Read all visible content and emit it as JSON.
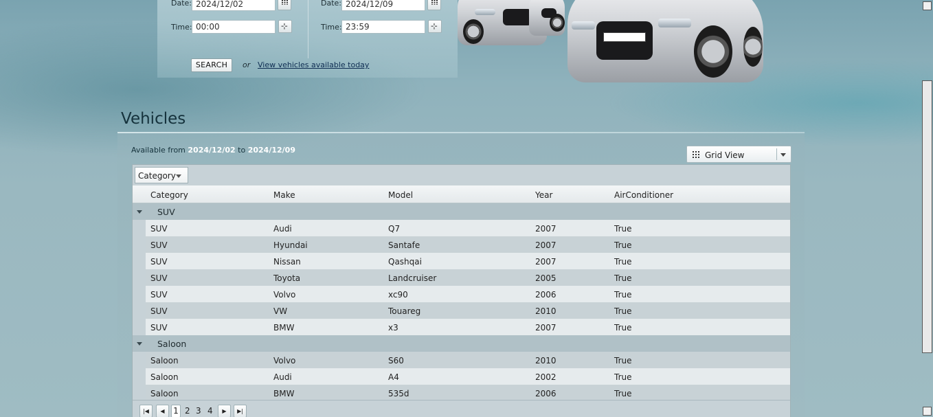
{
  "search": {
    "from_date_label": "Date:",
    "from_date_value": "2024/12/02",
    "from_time_label": "Time:",
    "from_time_value": "00:00",
    "to_date_label": "Date:",
    "to_date_value": "2024/12/09",
    "to_time_label": "Time:",
    "to_time_value": "23:59",
    "search_button": "SEARCH",
    "or_text": "or",
    "today_link": "View vehicles available today"
  },
  "vehicles": {
    "title": "Vehicles",
    "available_prefix": "Available from",
    "available_from": "2024/12/02",
    "available_to_word": "to",
    "available_to": "2024/12/09",
    "view_select": "Grid View",
    "group_chip": "Category"
  },
  "grid": {
    "columns": [
      "Category",
      "Make",
      "Model",
      "Year",
      "AirConditioner"
    ],
    "groups": [
      {
        "label": "SUV",
        "rows": [
          [
            "SUV",
            "Audi",
            "Q7",
            "2007",
            "True"
          ],
          [
            "SUV",
            "Hyundai",
            "Santafe",
            "2007",
            "True"
          ],
          [
            "SUV",
            "Nissan",
            "Qashqai",
            "2007",
            "True"
          ],
          [
            "SUV",
            "Toyota",
            "Landcruiser",
            "2005",
            "True"
          ],
          [
            "SUV",
            "Volvo",
            "xc90",
            "2006",
            "True"
          ],
          [
            "SUV",
            "VW",
            "Touareg",
            "2010",
            "True"
          ],
          [
            "SUV",
            "BMW",
            "x3",
            "2007",
            "True"
          ]
        ]
      },
      {
        "label": "Saloon",
        "rows": [
          [
            "Saloon",
            "Volvo",
            "S60",
            "2010",
            "True"
          ],
          [
            "Saloon",
            "Audi",
            "A4",
            "2002",
            "True"
          ],
          [
            "Saloon",
            "BMW",
            "535d",
            "2006",
            "True"
          ]
        ]
      }
    ]
  },
  "pager": {
    "first_icon": "first-page-icon",
    "prev_icon": "prev-page-icon",
    "next_icon": "next-page-icon",
    "last_icon": "last-page-icon",
    "pages": [
      "1",
      "2",
      "3",
      "4"
    ],
    "current_page": "1"
  },
  "icons": {
    "calendar": "calendar-icon",
    "clock": "clock-icon",
    "grid_view": "grid-view-icon",
    "dropdown": "chevron-down-icon"
  }
}
